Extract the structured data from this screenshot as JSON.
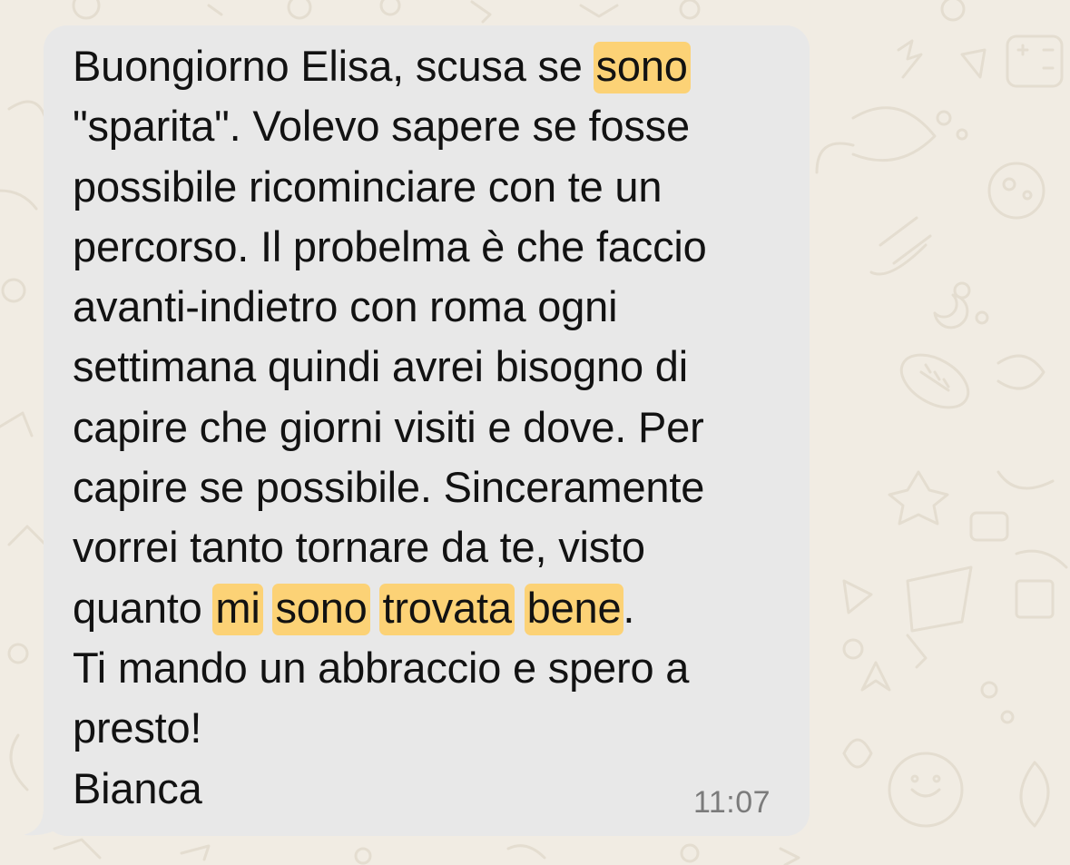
{
  "chat": {
    "message": {
      "lines": [
        "Buongiorno Elisa, scusa se ",
        "sono",
        "\"sparita\". Volevo sapere se fosse",
        "possibile ricominciare con te un",
        "percorso. Il probelma è che faccio",
        "avanti-indietro con roma ogni",
        "settimana quindi avrei bisogno di",
        "capire che giorni visiti e dove. Per",
        "capire se possibile. Sinceramente",
        "vorrei tanto tornare da te, visto",
        "quanto ",
        "mi",
        "sono",
        "trovata",
        "bene",
        ".",
        "Ti mando un abbraccio e spero a",
        "presto!",
        "Bianca"
      ],
      "time": "11:07"
    },
    "colors": {
      "wallpaper": "#f1ece3",
      "bubble": "#e8e8e8",
      "highlight": "#fcd276",
      "text": "#121212",
      "timestamp": "#7b7b7b"
    }
  }
}
